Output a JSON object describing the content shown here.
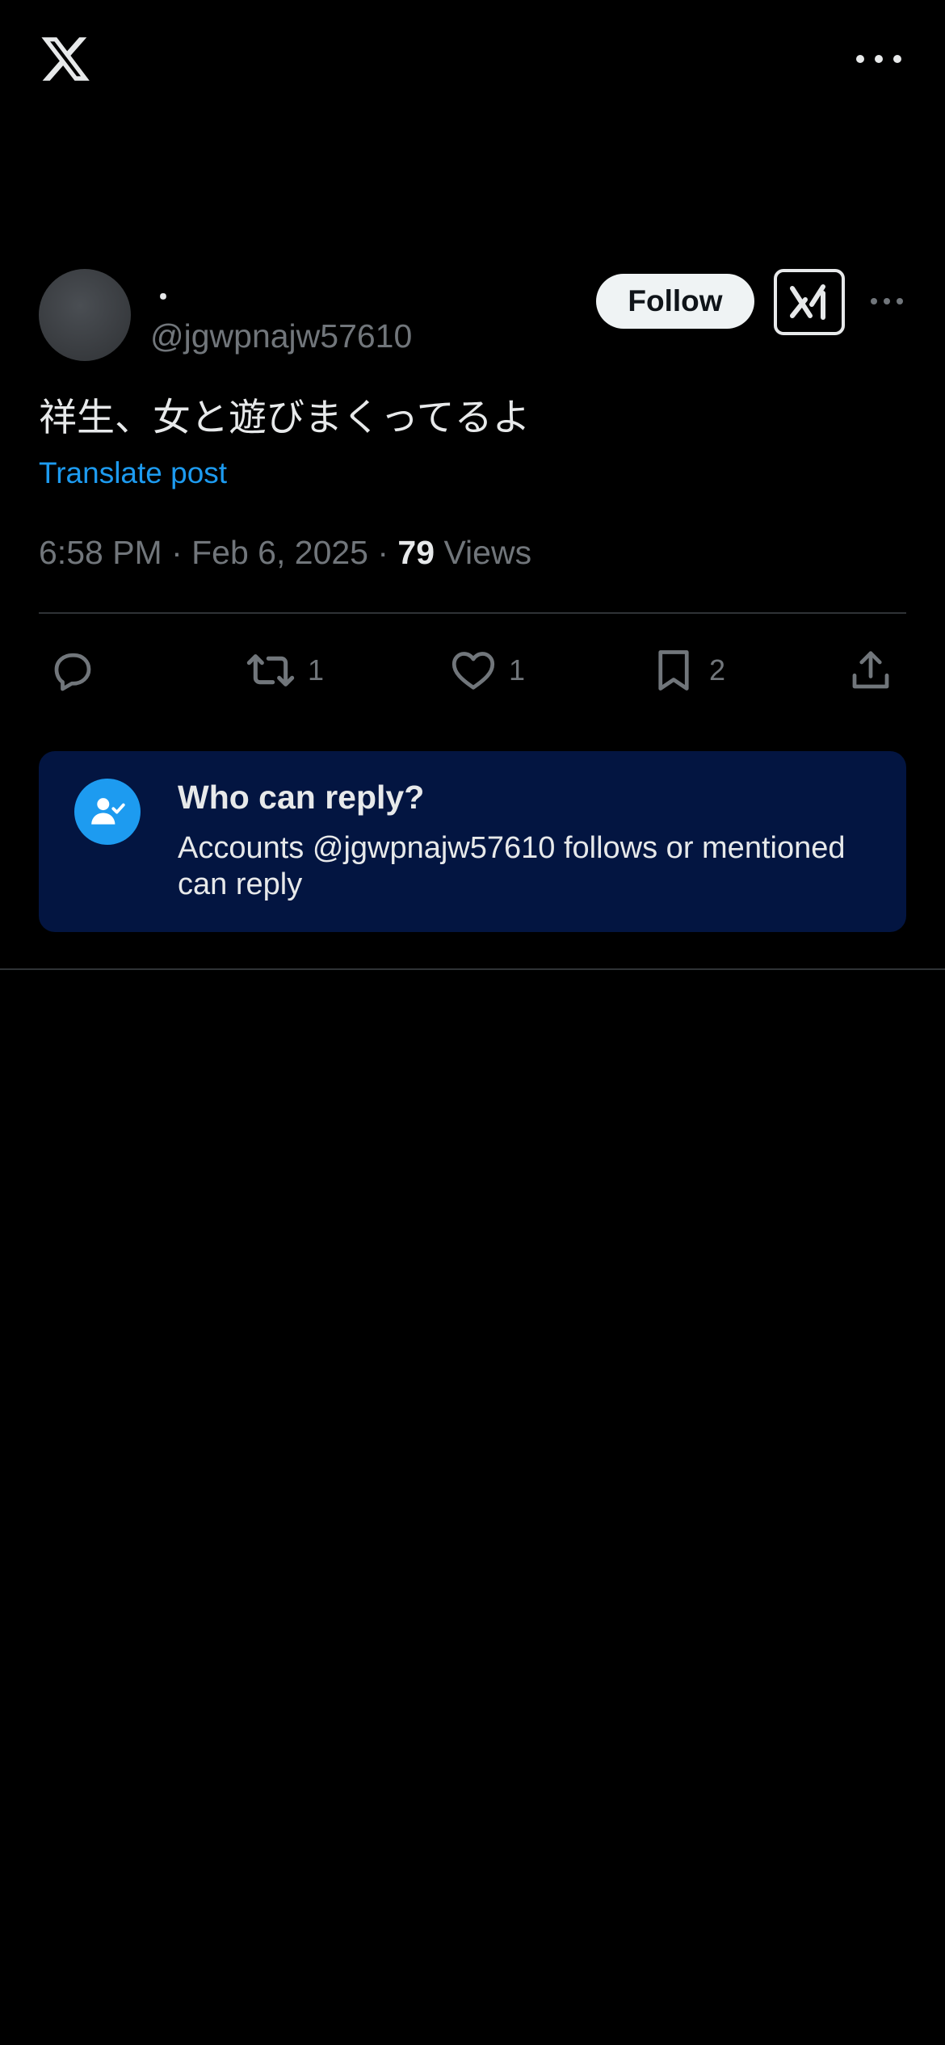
{
  "header": {
    "logo_icon": "x-logo-icon",
    "more_icon": "more-horizontal-icon"
  },
  "post": {
    "author": {
      "display_name": "・",
      "handle": "@jgwpnajw57610"
    },
    "follow_label": "Follow",
    "grok_icon": "grok-icon",
    "more_icon": "more-horizontal-icon",
    "text": "祥生、女と遊びまくってるよ",
    "translate_label": "Translate post",
    "time": "6:58 PM",
    "separator": " · ",
    "date": "Feb 6, 2025",
    "views_count": "79",
    "views_label": "Views"
  },
  "actions": {
    "reply": {
      "icon": "reply-icon",
      "count": ""
    },
    "repost": {
      "icon": "repost-icon",
      "count": "1"
    },
    "like": {
      "icon": "heart-icon",
      "count": "1"
    },
    "bookmark": {
      "icon": "bookmark-icon",
      "count": "2"
    },
    "share": {
      "icon": "share-icon"
    }
  },
  "reply_restriction": {
    "icon": "user-check-icon",
    "title": "Who can reply?",
    "description": "Accounts @jgwpnajw57610 follows or mentioned can reply"
  },
  "colors": {
    "background": "#000000",
    "text_primary": "#e7e9ea",
    "text_secondary": "#71767b",
    "accent": "#1d9bf0",
    "card_background": "#031541"
  }
}
